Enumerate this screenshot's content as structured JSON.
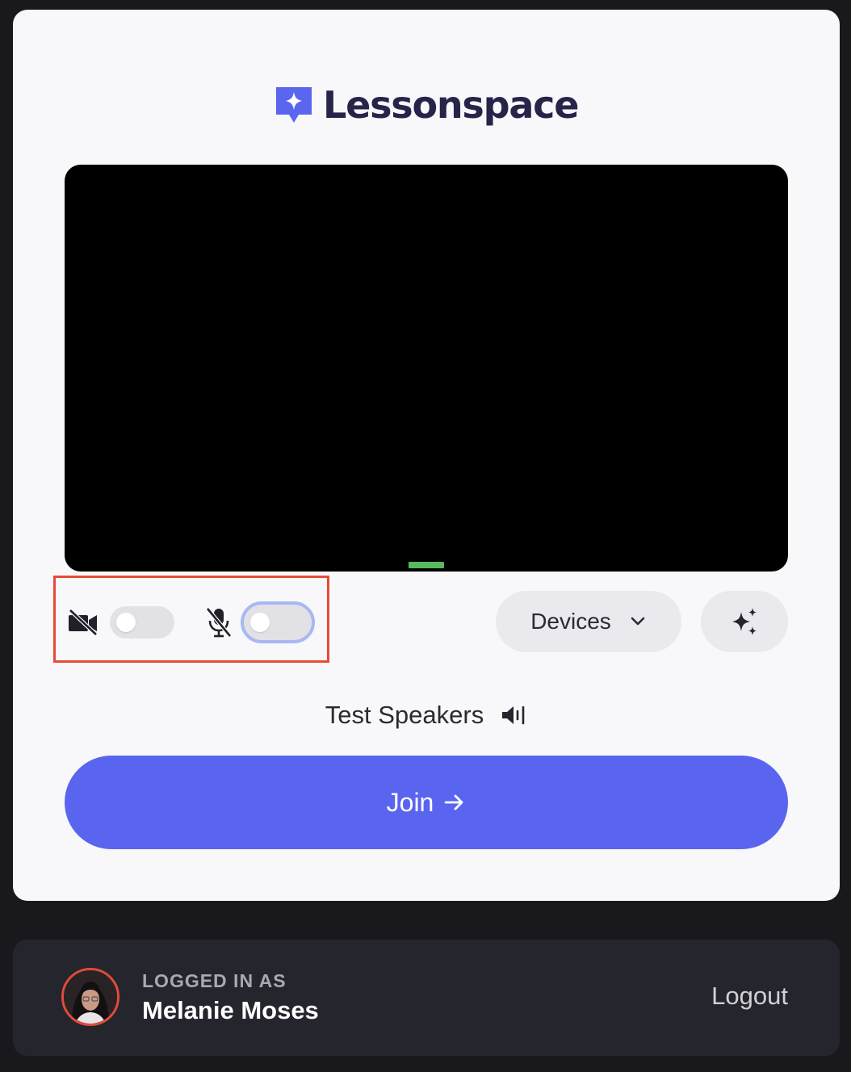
{
  "app": {
    "name": "Lessonspace"
  },
  "preview": {
    "audio_level_color": "#57b95e"
  },
  "controls": {
    "camera": {
      "icon": "camera-off-icon",
      "enabled": false
    },
    "microphone": {
      "icon": "mic-off-icon",
      "enabled": false,
      "focused": true
    },
    "devices_label": "Devices",
    "devices_icon": "chevron-down-icon",
    "effects_icon": "sparkles-icon"
  },
  "test_speakers": {
    "label": "Test Speakers",
    "icon": "speaker-icon"
  },
  "join": {
    "label": "Join",
    "icon": "arrow-right-icon",
    "color": "#5965ef"
  },
  "footer": {
    "logged_in_label": "LOGGED IN AS",
    "user_name": "Melanie Moses",
    "logout_label": "Logout",
    "avatar_ring_color": "#e24a3d"
  },
  "colors": {
    "page_bg": "#18181d",
    "card_bg": "#f8f8fa",
    "brand_text": "#27244a",
    "brand_mark": "#5a66ef",
    "highlight": "#e84a37"
  }
}
